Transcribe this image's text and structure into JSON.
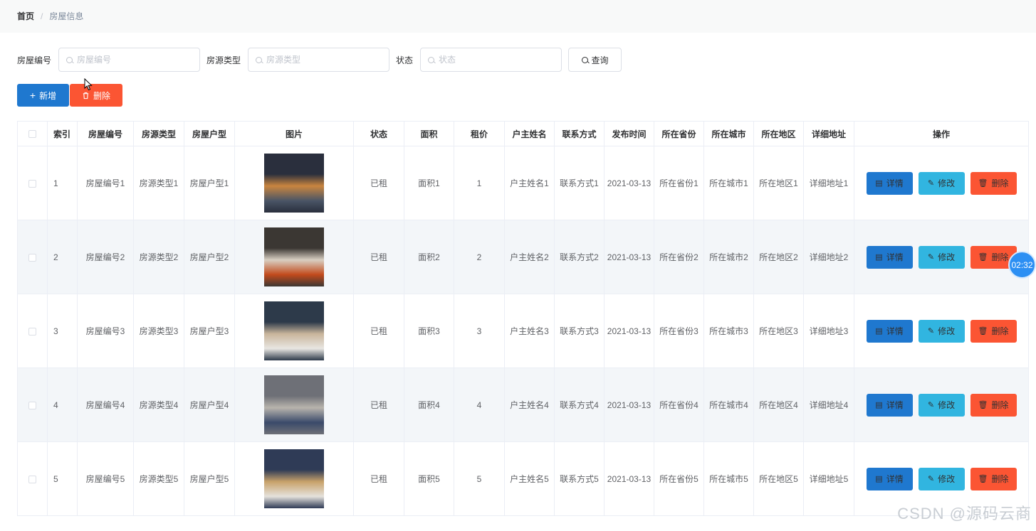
{
  "breadcrumb": {
    "home": "首页",
    "separator": "/",
    "current": "房屋信息"
  },
  "search": {
    "fields": [
      {
        "label": "房屋编号",
        "placeholder": "房屋编号"
      },
      {
        "label": "房源类型",
        "placeholder": "房源类型"
      },
      {
        "label": "状态",
        "placeholder": "状态"
      }
    ],
    "query_label": "查询"
  },
  "actions": {
    "add_label": "新增",
    "delete_label": "删除"
  },
  "table": {
    "headers": [
      "索引",
      "房屋编号",
      "房源类型",
      "房屋户型",
      "图片",
      "状态",
      "面积",
      "租价",
      "户主姓名",
      "联系方式",
      "发布时间",
      "所在省份",
      "所在城市",
      "所在地区",
      "详细地址",
      "操作"
    ],
    "rows": [
      {
        "index": "1",
        "code": "房屋编号1",
        "source": "房源类型1",
        "layout": "房屋户型1",
        "status": "已租",
        "area": "面积1",
        "rent": "1",
        "owner": "户主姓名1",
        "contact": "联系方式1",
        "date": "2021-03-13",
        "province": "所在省份1",
        "city": "所在城市1",
        "district": "所在地区1",
        "address": "详细地址1"
      },
      {
        "index": "2",
        "code": "房屋编号2",
        "source": "房源类型2",
        "layout": "房屋户型2",
        "status": "已租",
        "area": "面积2",
        "rent": "2",
        "owner": "户主姓名2",
        "contact": "联系方式2",
        "date": "2021-03-13",
        "province": "所在省份2",
        "city": "所在城市2",
        "district": "所在地区2",
        "address": "详细地址2"
      },
      {
        "index": "3",
        "code": "房屋编号3",
        "source": "房源类型3",
        "layout": "房屋户型3",
        "status": "已租",
        "area": "面积3",
        "rent": "3",
        "owner": "户主姓名3",
        "contact": "联系方式3",
        "date": "2021-03-13",
        "province": "所在省份3",
        "city": "所在城市3",
        "district": "所在地区3",
        "address": "详细地址3"
      },
      {
        "index": "4",
        "code": "房屋编号4",
        "source": "房源类型4",
        "layout": "房屋户型4",
        "status": "已租",
        "area": "面积4",
        "rent": "4",
        "owner": "户主姓名4",
        "contact": "联系方式4",
        "date": "2021-03-13",
        "province": "所在省份4",
        "city": "所在城市4",
        "district": "所在地区4",
        "address": "详细地址4"
      },
      {
        "index": "5",
        "code": "房屋编号5",
        "source": "房源类型5",
        "layout": "房屋户型5",
        "status": "已租",
        "area": "面积5",
        "rent": "5",
        "owner": "户主姓名5",
        "contact": "联系方式5",
        "date": "2021-03-13",
        "province": "所在省份5",
        "city": "所在城市5",
        "district": "所在地区5",
        "address": "详细地址5"
      }
    ],
    "row_actions": {
      "detail": "详情",
      "edit": "修改",
      "delete": "删除"
    }
  },
  "timer": "02:32",
  "watermark": "CSDN @源码云商",
  "colors": {
    "primary": "#1f78cf",
    "info": "#31b5e0",
    "danger": "#fb5533",
    "stripe": "#f3f6f9"
  },
  "icons": {
    "search": "search-icon",
    "add": "plus-icon",
    "delete": "trash-icon",
    "detail": "document-icon",
    "edit": "edit-icon"
  }
}
